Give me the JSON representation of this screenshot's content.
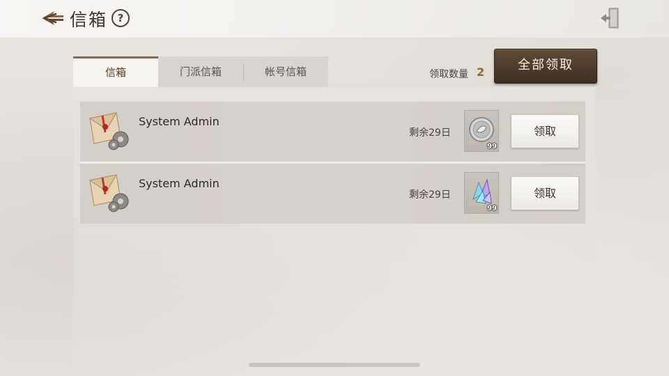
{
  "header": {
    "title": "信箱",
    "help_glyph": "?",
    "back_icon": "back-arrow-icon",
    "exit_icon": "exit-door-icon"
  },
  "tabs": [
    {
      "label": "信箱",
      "active": true
    },
    {
      "label": "门派信箱",
      "active": false
    },
    {
      "label": "帐号信箱",
      "active": false
    }
  ],
  "claim": {
    "count_label": "领取数量",
    "count_value": "2",
    "claim_all_label": "全部领取"
  },
  "mails": [
    {
      "sender": "System Admin",
      "days_left": "剩余29日",
      "item_icon": "silver-coin-icon",
      "item_count": "99",
      "claim_label": "领取"
    },
    {
      "sender": "System Admin",
      "days_left": "剩余29日",
      "item_icon": "crystal-shard-icon",
      "item_count": "99",
      "claim_label": "领取"
    }
  ],
  "colors": {
    "accent_brown": "#3e2f23",
    "tab_active_border": "#8a6a4a",
    "count_value": "#8a6a3a"
  }
}
